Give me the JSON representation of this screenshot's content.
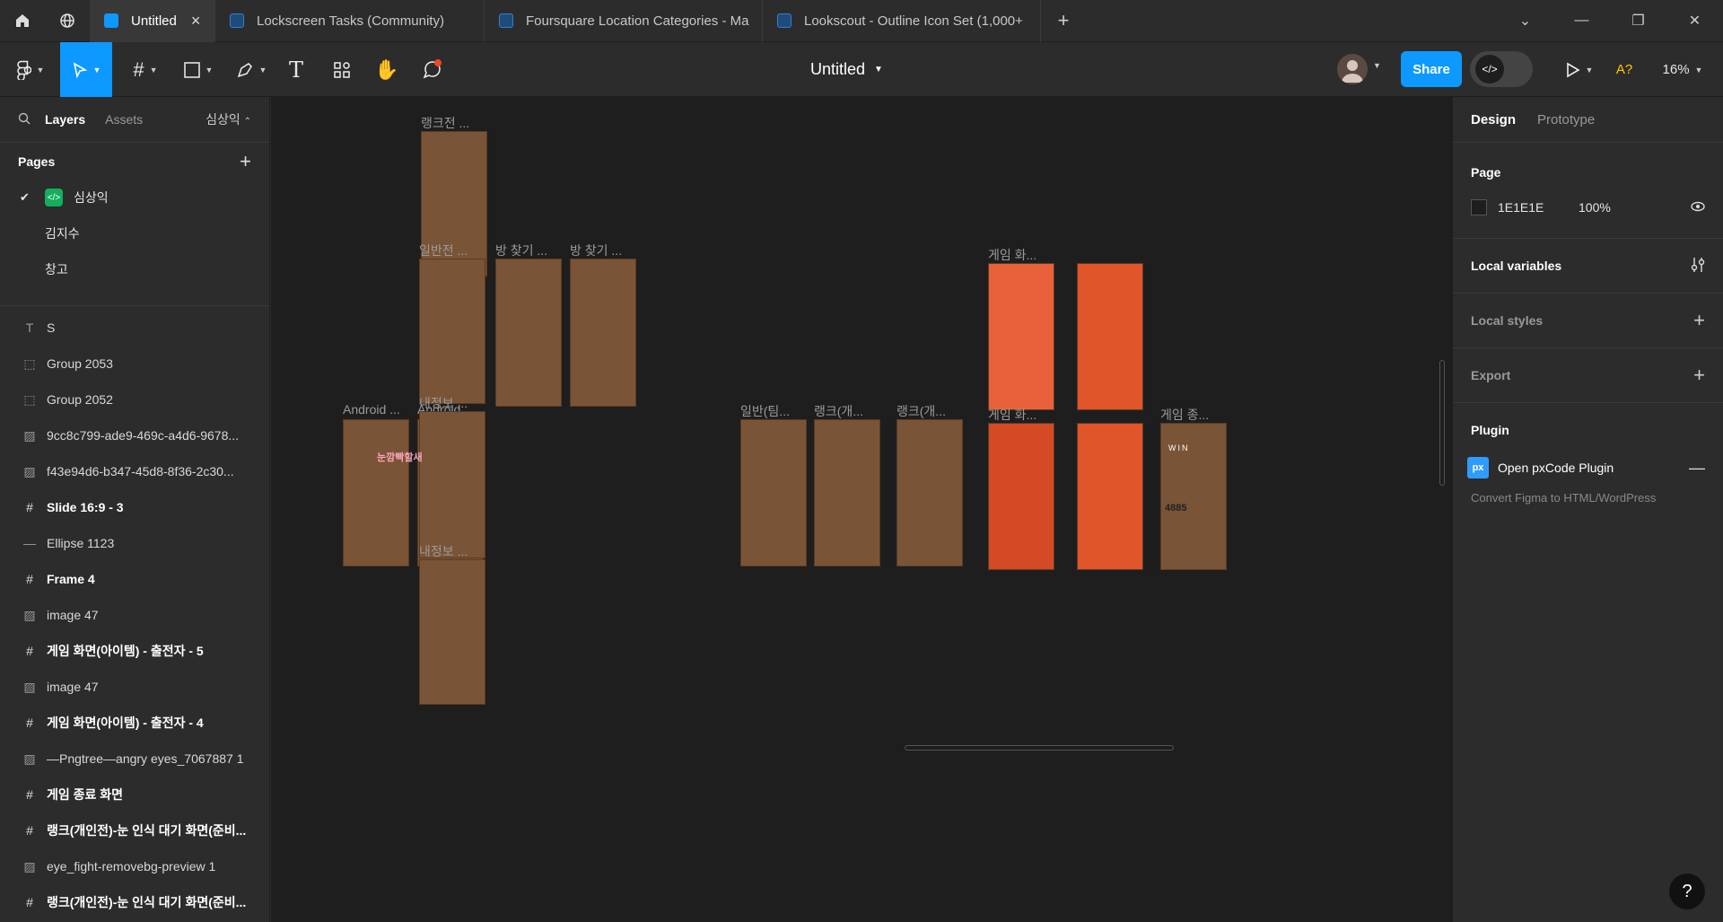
{
  "tabs": [
    {
      "label": "Untitled",
      "active": true
    },
    {
      "label": "Lockscreen Tasks (Community)"
    },
    {
      "label": "Foursquare Location Categories - Ma"
    },
    {
      "label": "Lookscout - Outline Icon Set (1,000+"
    }
  ],
  "toolbar": {
    "file_name": "Untitled",
    "share_label": "Share",
    "zoom": "16%",
    "accent": "#0d99ff"
  },
  "left": {
    "tab_layers": "Layers",
    "tab_assets": "Assets",
    "page_switch": "심상익",
    "pages_title": "Pages",
    "pages": [
      {
        "name": "심상익",
        "current": true
      },
      {
        "name": "김지수"
      },
      {
        "name": "창고"
      }
    ],
    "layers": [
      {
        "name": "S",
        "icon": "text-icon"
      },
      {
        "name": "Group 2053",
        "icon": "group-icon"
      },
      {
        "name": "Group 2052",
        "icon": "group-icon"
      },
      {
        "name": "9cc8c799-ade9-469c-a4d6-9678...",
        "icon": "image-icon"
      },
      {
        "name": "f43e94d6-b347-45d8-8f36-2c30...",
        "icon": "image-icon"
      },
      {
        "name": "Slide 16:9 - 3",
        "icon": "frame-icon"
      },
      {
        "name": "Ellipse 1123",
        "icon": "line-icon"
      },
      {
        "name": "Frame 4",
        "icon": "frame-icon"
      },
      {
        "name": "image 47",
        "icon": "image-icon"
      },
      {
        "name": "게임 화면(아이템) - 출전자 - 5",
        "icon": "frame-icon"
      },
      {
        "name": "image 47",
        "icon": "image-icon"
      },
      {
        "name": "게임 화면(아이템) - 출전자 - 4",
        "icon": "frame-icon"
      },
      {
        "name": "—Pngtree—angry eyes_7067887 1",
        "icon": "image-icon"
      },
      {
        "name": "게임 종료 화면",
        "icon": "frame-icon"
      },
      {
        "name": "랭크(개인전)-눈 인식 대기 화면(준비...",
        "icon": "frame-icon"
      },
      {
        "name": "eye_fight-removebg-preview 1",
        "icon": "image-icon"
      },
      {
        "name": "랭크(개인전)-눈 인식 대기 화면(준비...",
        "icon": "frame-icon"
      }
    ]
  },
  "canvas": {
    "frames": [
      {
        "label": "랭크전 ..."
      },
      {
        "label": "일반전 ..."
      },
      {
        "label": "방 찾기 ..."
      },
      {
        "label": "방 찾기 ..."
      },
      {
        "label": "Android ..."
      },
      {
        "label": "Android ..."
      },
      {
        "label": "내정보 ..."
      },
      {
        "label": "내정보 ..."
      },
      {
        "label": "일반(팀..."
      },
      {
        "label": "랭크(개..."
      },
      {
        "label": "랭크(개..."
      },
      {
        "label": "게임 화..."
      },
      {
        "label": "게임 화..."
      },
      {
        "label": "게임 종..."
      }
    ],
    "inner_texts": {
      "title_art": "눈깜빡할새",
      "score": "4885",
      "win": "WIN"
    }
  },
  "right": {
    "tab_design": "Design",
    "tab_prototype": "Prototype",
    "page_title": "Page",
    "page_color": "1E1E1E",
    "page_color_hex": "#1e1e1e",
    "page_opacity": "100%",
    "local_variables": "Local variables",
    "local_styles": "Local styles",
    "export": "Export",
    "plugin_title": "Plugin",
    "plugin_name": "Open pxCode Plugin",
    "plugin_desc": "Convert Figma to HTML/WordPress"
  }
}
